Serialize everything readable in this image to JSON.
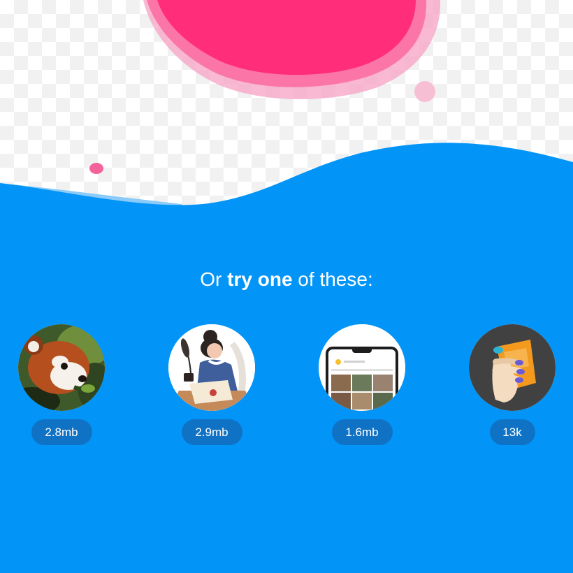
{
  "heading": {
    "prefix": "Or ",
    "emphasis": "try one",
    "suffix": " of these:"
  },
  "samples": [
    {
      "id": "red-panda",
      "icon": "red-panda-photo",
      "size": "2.8mb"
    },
    {
      "id": "illustration",
      "icon": "writing-woman-illustration",
      "size": "2.9mb"
    },
    {
      "id": "device-screen",
      "icon": "phone-screenshot",
      "size": "1.6mb"
    },
    {
      "id": "svg-hand",
      "icon": "hand-vector-graphic",
      "size": "13k"
    }
  ],
  "colors": {
    "background_wave": "#0295f7",
    "blob_pink": "#ff2d7a",
    "blob_light_pink": "#f7a7c7",
    "pill": "#1072c4",
    "text": "#ffffff"
  }
}
